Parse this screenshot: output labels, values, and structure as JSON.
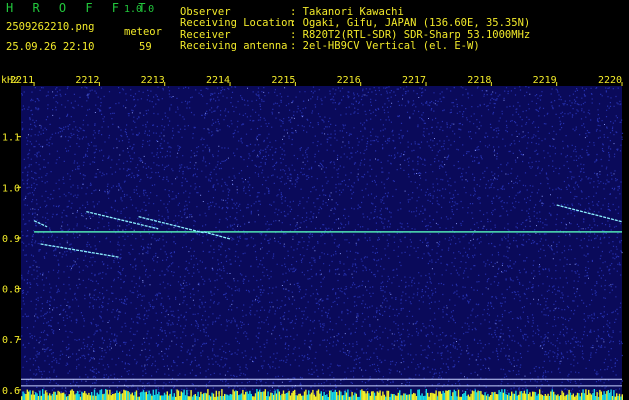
{
  "header": {
    "app_title": "H R O F F T",
    "version": "1.0.0",
    "filename": "2509262210.png",
    "timestamp": "25.09.26 22:10",
    "count_label": "meteor",
    "count_value": "59",
    "info": [
      {
        "label": "Observer",
        "value": ": Takanori Kawachi"
      },
      {
        "label": "Receiving Location",
        "value": ": Ogaki, Gifu, JAPAN (136.60E, 35.35N)"
      },
      {
        "label": "Receiver",
        "value": ": R820T2(RTL-SDR) SDR-Sharp 53.1000MHz"
      },
      {
        "label": "Receiving antenna",
        "value": ": 2el-HB9CV Vertical (el. E-W)"
      }
    ]
  },
  "colors": {
    "text_green": "#22c83c",
    "text_yellow": "#f2ea2a",
    "background": "#0a0a5a",
    "noise": "#2e3cc8",
    "trace": "#8cf0ff",
    "carrier": "#50e6b4",
    "bar_cyan": "#16d8e6",
    "bar_yellow": "#f0f028"
  },
  "chart_data": {
    "type": "heatmap",
    "ylabel": "kHz",
    "xlim": [
      2210.8,
      2220.0
    ],
    "ylim": [
      0.58,
      1.2
    ],
    "x_ticks": [
      2211,
      2212,
      2213,
      2214,
      2215,
      2216,
      2217,
      2218,
      2219,
      2220
    ],
    "y_ticks": [
      0.6,
      0.7,
      0.8,
      0.9,
      1.0,
      1.1
    ],
    "x_tick_labels": [
      "2211",
      "2212",
      "2213",
      "2214",
      "2215",
      "2216",
      "2217",
      "2218",
      "2219",
      "2220"
    ],
    "y_tick_labels": [
      "0.6",
      "0.7",
      "0.8",
      "0.9",
      "1.0",
      "1.1"
    ],
    "carrier": {
      "x": [
        2211.0,
        2220.0
      ],
      "y": 0.912
    },
    "traces": [
      {
        "x": [
          2211.0,
          2211.2
        ],
        "y": [
          0.934,
          0.922
        ]
      },
      {
        "x": [
          2211.8,
          2212.9
        ],
        "y": [
          0.952,
          0.918
        ]
      },
      {
        "x": [
          2212.6,
          2213.6
        ],
        "y": [
          0.942,
          0.91
        ]
      },
      {
        "x": [
          2213.6,
          2214.0
        ],
        "y": [
          0.912,
          0.898
        ]
      },
      {
        "x": [
          2211.1,
          2212.3
        ],
        "y": [
          0.888,
          0.862
        ]
      },
      {
        "x": [
          2219.0,
          2220.0
        ],
        "y": [
          0.965,
          0.932
        ]
      }
    ],
    "reference_lines": [
      0.621,
      0.608
    ],
    "activity_bars": "present along bottom edge"
  }
}
